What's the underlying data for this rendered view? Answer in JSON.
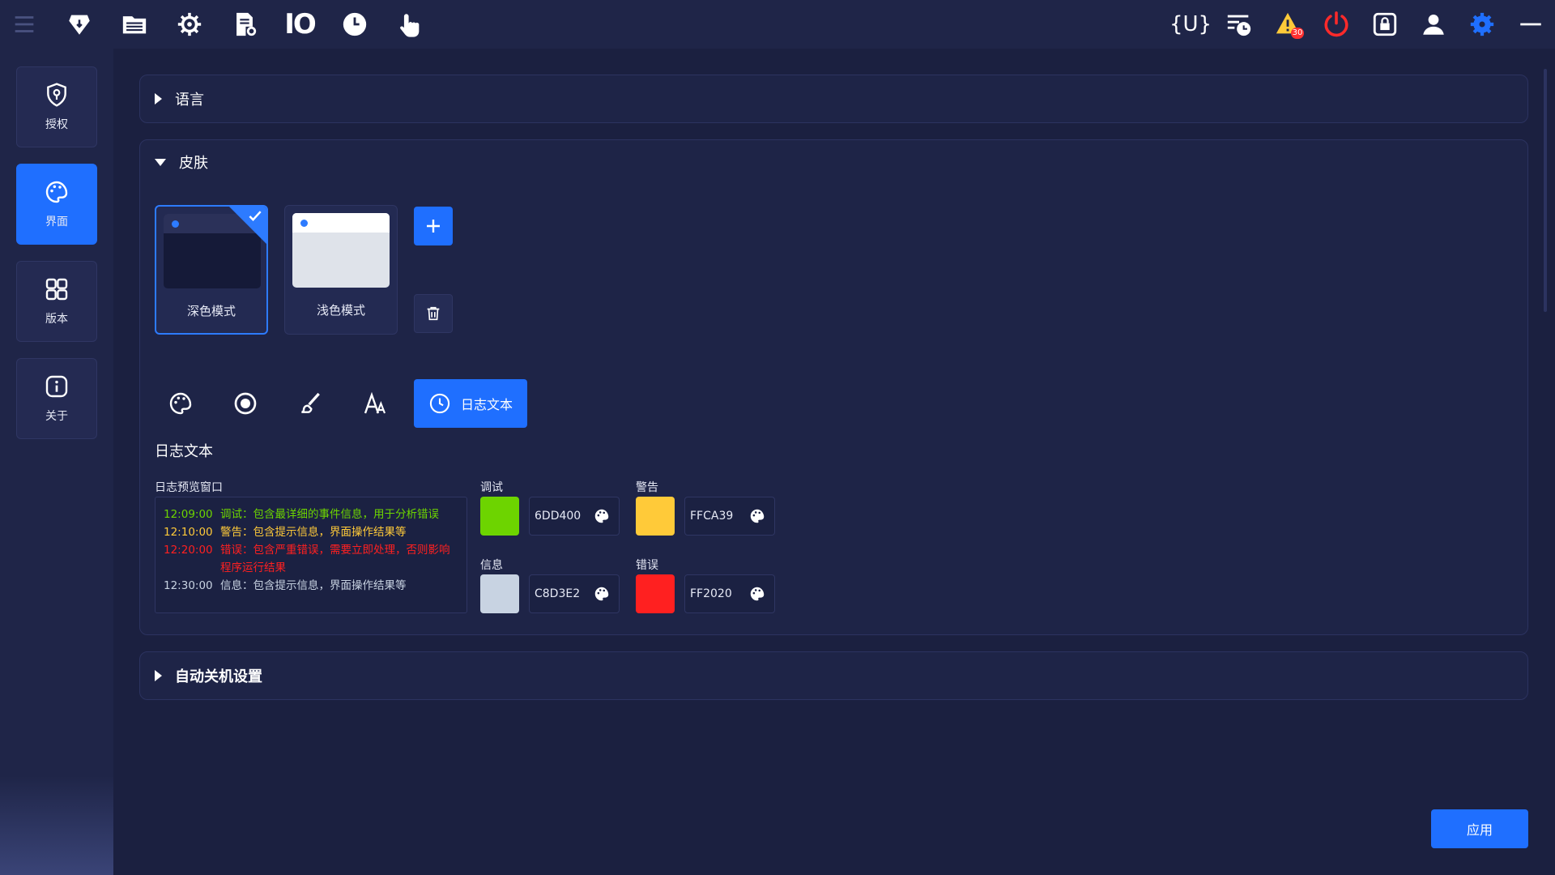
{
  "topbar": {
    "left_icons": [
      "menu-icon",
      "shield-code-icon",
      "folder-list-icon",
      "gear-network-icon",
      "file-settings-icon",
      "io-icon",
      "clock-icon",
      "touch-icon"
    ],
    "io_label": "IO",
    "u_label": "{U}",
    "alarm_count": "30",
    "right_icons": [
      "variable-icon",
      "schedule-list-icon",
      "warning-icon",
      "power-icon",
      "lock-screen-icon",
      "user-icon",
      "settings-icon",
      "minimize-icon"
    ]
  },
  "sidebar": {
    "items": [
      {
        "label": "授权",
        "icon": "license-shield-icon",
        "active": false
      },
      {
        "label": "界面",
        "icon": "palette-icon",
        "active": true
      },
      {
        "label": "版本",
        "icon": "grid-icon",
        "active": false
      },
      {
        "label": "关于",
        "icon": "info-icon",
        "active": false
      }
    ]
  },
  "sections": {
    "language": {
      "title": "语言",
      "expanded": false
    },
    "skin": {
      "title": "皮肤",
      "expanded": true,
      "cards": [
        {
          "label": "深色模式",
          "selected": true
        },
        {
          "label": "浅色模式",
          "selected": false
        }
      ],
      "add_button": "add-icon",
      "delete_button": "trash-icon"
    },
    "autoshutdown": {
      "title": "自动关机设置",
      "expanded": false
    }
  },
  "tools": {
    "items": [
      "palette-tool-icon",
      "radio-tool-icon",
      "brush-tool-icon",
      "font-tool-icon"
    ],
    "active_label": "日志文本"
  },
  "log_text": {
    "section_title": "日志文本",
    "preview_label": "日志预览窗口",
    "lines": [
      {
        "time": "12:09:00",
        "text": "调试：包含最详细的事件信息，用于分析错误"
      },
      {
        "time": "12:10:00",
        "text": "警告：包含提示信息，界面操作结果等"
      },
      {
        "time": "12:20:00",
        "text": "错误：包含严重错误，需要立即处理，否则影响程序运行结果"
      },
      {
        "time": "12:30:00",
        "text": "信息：包含提示信息，界面操作结果等"
      }
    ],
    "colors": {
      "debug": {
        "label": "调试",
        "hex": "6DD400",
        "color": "#6DD400"
      },
      "warning": {
        "label": "警告",
        "hex": "FFCA39",
        "color": "#FFCA39"
      },
      "info": {
        "label": "信息",
        "hex": "C8D3E2",
        "color": "#C8D3E2"
      },
      "error": {
        "label": "错误",
        "hex": "FF2020",
        "color": "#FF2020"
      }
    }
  },
  "apply_label": "应用"
}
